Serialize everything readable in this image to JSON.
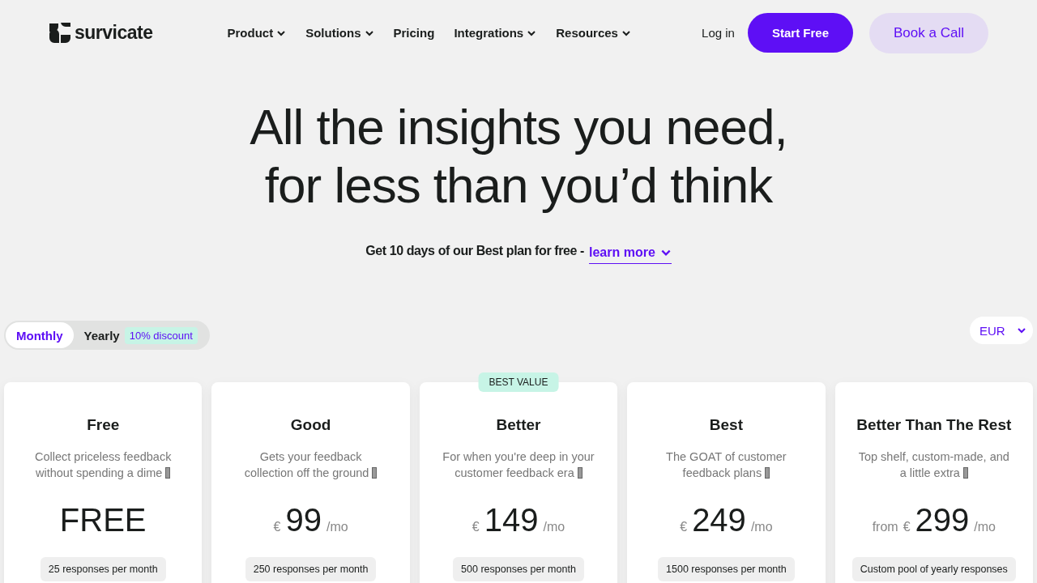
{
  "header": {
    "logo": "survicate",
    "nav": [
      {
        "label": "Product",
        "dropdown": true
      },
      {
        "label": "Solutions",
        "dropdown": true
      },
      {
        "label": "Pricing",
        "dropdown": false
      },
      {
        "label": "Integrations",
        "dropdown": true
      },
      {
        "label": "Resources",
        "dropdown": true
      }
    ],
    "login": "Log in",
    "primary_button": "Start Free",
    "secondary_button": "Book a Call"
  },
  "hero": {
    "title_lines": [
      "All the insights you need,",
      "for less than you’d think"
    ],
    "subtitle": "Get 10 days of our Best plan for free -",
    "link": "learn more"
  },
  "billing_toggle": [
    {
      "label": "Monthly",
      "selected": true
    },
    {
      "label": "Yearly",
      "selected": false,
      "badge": "10% discount"
    }
  ],
  "currency": "EUR",
  "plans": [
    {
      "name": "Free",
      "description": "Collect priceless feedback without spending a dime",
      "emoji": true,
      "price": "FREE",
      "quota": "25 responses per month"
    },
    {
      "name": "Good",
      "description": "Gets your feedback collection off the ground",
      "emoji": true,
      "currency": "€",
      "price": "99",
      "period": "/mo",
      "quota": "250 responses per month"
    },
    {
      "name": "Better",
      "badge": "BEST VALUE",
      "description": "For when you're deep in your customer feedback era",
      "emoji": true,
      "currency": "€",
      "price": "149",
      "period": "/mo",
      "quota": "500 responses per month"
    },
    {
      "name": "Best",
      "description": "The GOAT of customer feedback plans",
      "emoji": true,
      "currency": "€",
      "price": "249",
      "period": "/mo",
      "quota": "1500 responses per month"
    },
    {
      "name": "Better Than The Rest",
      "description": "Top shelf, custom-made, and a little extra",
      "emoji": true,
      "prefix": "from",
      "currency": "€",
      "price": "299",
      "period": "/mo",
      "quota": "Custom pool of yearly responses"
    }
  ]
}
